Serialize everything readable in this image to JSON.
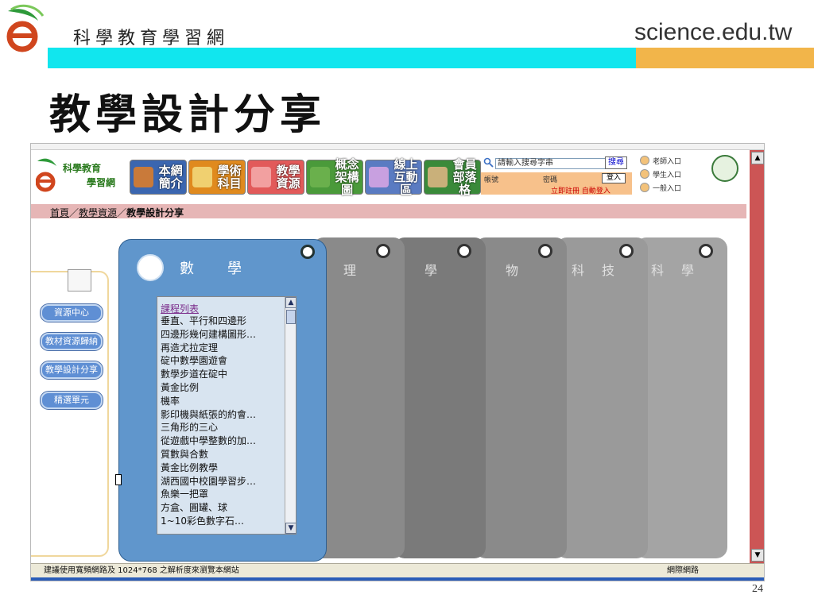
{
  "slide": {
    "site_name": "科學教育學習網",
    "site_url": "science.edu.tw",
    "title": "教學設計分享",
    "page_number": "24"
  },
  "site": {
    "logo_line1": "科學教育",
    "logo_line2": "學習網",
    "nav": [
      {
        "label": "本網簡介",
        "color": "#3b66b0"
      },
      {
        "label": "學術科目",
        "color": "#e08a1e"
      },
      {
        "label": "教學資源",
        "color": "#e25a5a"
      },
      {
        "label": "概念架構圖",
        "color": "#4a9a3a"
      },
      {
        "label": "線上互動區",
        "color": "#5a7bc2"
      },
      {
        "label": "會員部落格",
        "color": "#3a8a3a"
      }
    ],
    "search": {
      "placeholder": "請輸入搜尋字串",
      "button": "搜尋"
    },
    "login": {
      "account_label": "帳號",
      "password_label": "密碼",
      "login_button": "登入",
      "register_link": "立即註冊",
      "auto_login_link": "自動登入"
    },
    "entries": [
      "老師入口",
      "學生入口",
      "一般入口"
    ],
    "breadcrumb": {
      "home": "首頁",
      "section": "教學資源",
      "current": "教學設計分享",
      "separator": "／"
    },
    "sidebar_buttons": [
      "資源中心",
      "教材資源歸納",
      "教學設計分享",
      "精選單元"
    ],
    "tabs": [
      {
        "label": "數學",
        "active": true
      },
      {
        "label": "理",
        "color": "#8a8a8a"
      },
      {
        "label": "學",
        "color": "#7a7a7a"
      },
      {
        "label": "物",
        "color": "#8a8a8a"
      },
      {
        "label": "科技",
        "color": "#9a9a9a"
      },
      {
        "label": "科學",
        "color": "#a4a4a4"
      }
    ],
    "course_list": {
      "header": "課程列表",
      "items": [
        "垂直、平行和四邊形",
        "四邊形幾何建構圖形…",
        "再造尤拉定理",
        "碇中數學園遊會",
        "數學步道在碇中",
        "黃金比例",
        "機率",
        "影印機與紙張的約會…",
        "三角形的三心",
        "從遊戲中學整數的加…",
        "質數與合數",
        "黃金比例教學",
        "湖西國中校園學習步…",
        "魚樂一把罩",
        "方盒、圓罐、球",
        "1~10彩色數字石…"
      ]
    },
    "status": {
      "message": "建議使用寬頻網路及 1024*768 之解析度來瀏覽本網站",
      "zone": "網際網路"
    }
  }
}
